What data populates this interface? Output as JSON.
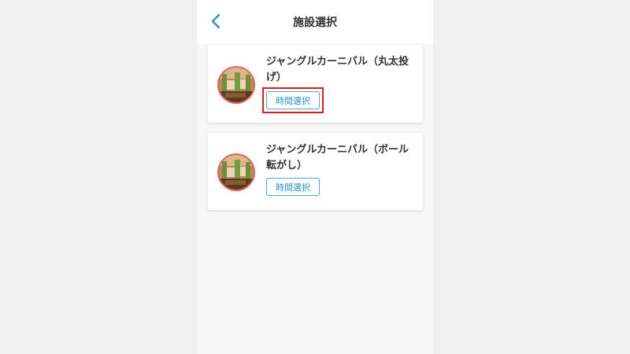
{
  "header": {
    "title": "施設選択",
    "back_icon": "chevron-left-icon"
  },
  "colors": {
    "accent": "#2c8fcc",
    "highlight": "#e01b1b",
    "thumb_border": "#e8625c"
  },
  "facilities": [
    {
      "name": "ジャングルカーニバル（丸太投げ）",
      "button_label": "時間選択",
      "highlighted": true
    },
    {
      "name": "ジャングルカーニバル（ボール転がし）",
      "button_label": "時間選択",
      "highlighted": false
    }
  ]
}
